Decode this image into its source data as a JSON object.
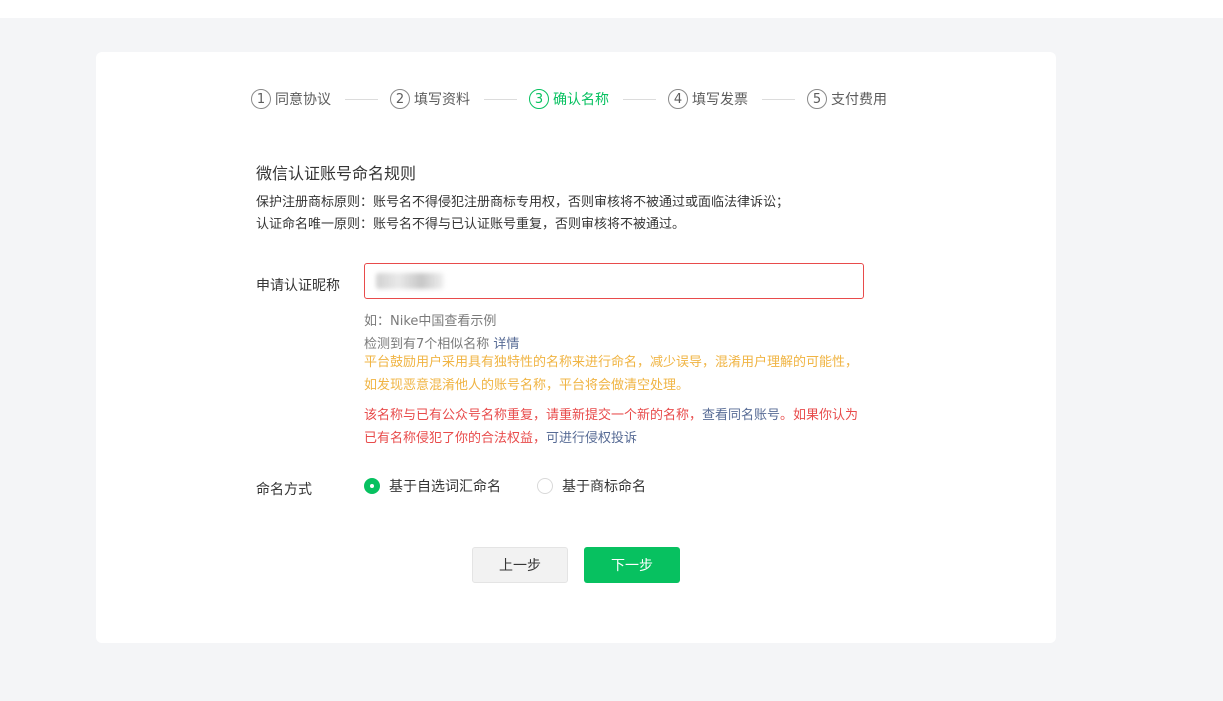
{
  "steps": [
    {
      "num": "1",
      "label": "同意协议",
      "state": "done"
    },
    {
      "num": "2",
      "label": "填写资料",
      "state": "done"
    },
    {
      "num": "3",
      "label": "确认名称",
      "state": "active"
    },
    {
      "num": "4",
      "label": "填写发票",
      "state": "todo"
    },
    {
      "num": "5",
      "label": "支付费用",
      "state": "todo"
    }
  ],
  "rules": {
    "title": "微信认证账号命名规则",
    "line1": "保护注册商标原则：账号名不得侵犯注册商标专用权，否则审核将不被通过或面临法律诉讼；",
    "line2": "认证命名唯一原则：账号名不得与已认证账号重复，否则审核将不被通过。"
  },
  "form": {
    "name_label": "申请认证昵称",
    "name_value": "",
    "example_hint": "如：Nike中国查看示例",
    "similar_text": "检测到有7个相似名称",
    "similar_link": "详情",
    "yellow_warning_1": "平台鼓励用户采用具有独特性的名称来进行命名，减少误导，混淆用户理解的可能性，",
    "yellow_warning_2": "如发现恶意混淆他人的账号名称，平台将会做清空处理。",
    "red_warning_1a": "该名称与已有公众号名称重复，请重新提交一个新的名称，",
    "red_warning_link1": "查看同名账号",
    "red_warning_1b": "。如果你认为",
    "red_warning_2a": "已有名称侵犯了你的合法权益，",
    "red_warning_link2": "可进行侵权投诉",
    "method_label": "命名方式",
    "method_options": [
      {
        "label": "基于自选词汇命名",
        "checked": true
      },
      {
        "label": "基于商标命名",
        "checked": false
      }
    ]
  },
  "buttons": {
    "prev": "上一步",
    "next": "下一步"
  },
  "colors": {
    "accent": "#07c160",
    "error": "#e84b4b",
    "warning": "#f0b443",
    "link": "#576b95"
  }
}
